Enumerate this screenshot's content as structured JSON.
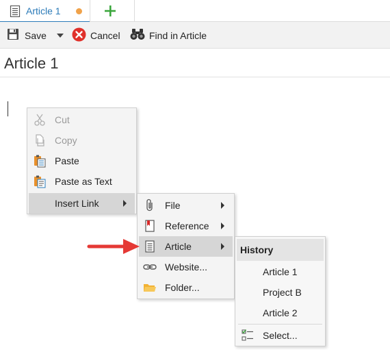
{
  "tabs": [
    {
      "label": "Article 1",
      "active": true,
      "unsaved": true
    }
  ],
  "toolbar": {
    "save_label": "Save",
    "cancel_label": "Cancel",
    "find_label": "Find in Article"
  },
  "article": {
    "title": "Article 1"
  },
  "context_menu": {
    "items": [
      {
        "label": "Cut",
        "icon": "scissors-icon",
        "enabled": false
      },
      {
        "label": "Copy",
        "icon": "copy-icon",
        "enabled": false
      },
      {
        "label": "Paste",
        "icon": "paste-icon",
        "enabled": true
      },
      {
        "label": "Paste as Text",
        "icon": "paste-text-icon",
        "enabled": true
      },
      {
        "label": "Insert Link",
        "icon": "",
        "enabled": true,
        "submenu": true,
        "highlighted": true
      }
    ]
  },
  "insert_link_menu": {
    "items": [
      {
        "label": "File",
        "icon": "paperclip-icon",
        "submenu": true
      },
      {
        "label": "Reference",
        "icon": "bookmark-icon",
        "submenu": true
      },
      {
        "label": "Article",
        "icon": "document-icon",
        "submenu": true,
        "highlighted": true
      },
      {
        "label": "Website...",
        "icon": "link-icon"
      },
      {
        "label": "Folder...",
        "icon": "folder-icon"
      }
    ]
  },
  "article_menu": {
    "header": "History",
    "items": [
      {
        "label": "Article 1"
      },
      {
        "label": "Project B"
      },
      {
        "label": "Article 2"
      }
    ],
    "select_label": "Select..."
  },
  "colors": {
    "accent": "#2a7ab8",
    "unsaved_dot": "#f0a24a",
    "cancel_red": "#e0312b",
    "add_green": "#3aa63c",
    "pointer_red": "#e53935"
  }
}
